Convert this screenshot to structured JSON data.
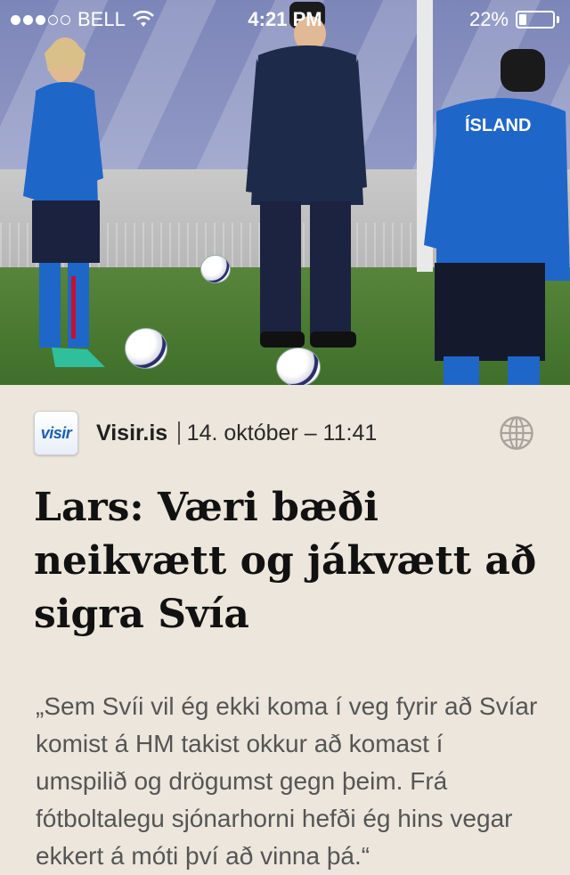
{
  "status_bar": {
    "carrier": "BELL",
    "time": "4:21 PM",
    "battery": "22%",
    "battery_level": 0.22,
    "signal_bars": 3,
    "signal_total": 5,
    "wifi_icon": "wifi-icon",
    "battery_icon": "battery-icon"
  },
  "hero": {
    "jersey_text": "ÍSLAND",
    "colors": {
      "banner": "#7d86b9",
      "grass": "#4a7a33",
      "jersey": "#1f66c9"
    }
  },
  "article": {
    "source_logo_text": "visir",
    "source_name": "Visir.is",
    "date": "14. október – 11:41",
    "headline": "Lars: Væri bæði neikvætt og jákvætt að sigra Svía",
    "body": "„Sem Svíi vil ég ekki koma í veg fyrir að Svíar komist á HM takist okkur að komast í umspilið og drögumst gegn þeim. Frá fótboltalegu sjónarhorni hefði ég hins vegar ekkert á móti því að vinna þá.“",
    "globe_icon": "globe-icon"
  },
  "colors": {
    "background": "#ede6dc",
    "headline": "#111111",
    "body": "#555555",
    "logo_blue": "#1a5fb4"
  }
}
